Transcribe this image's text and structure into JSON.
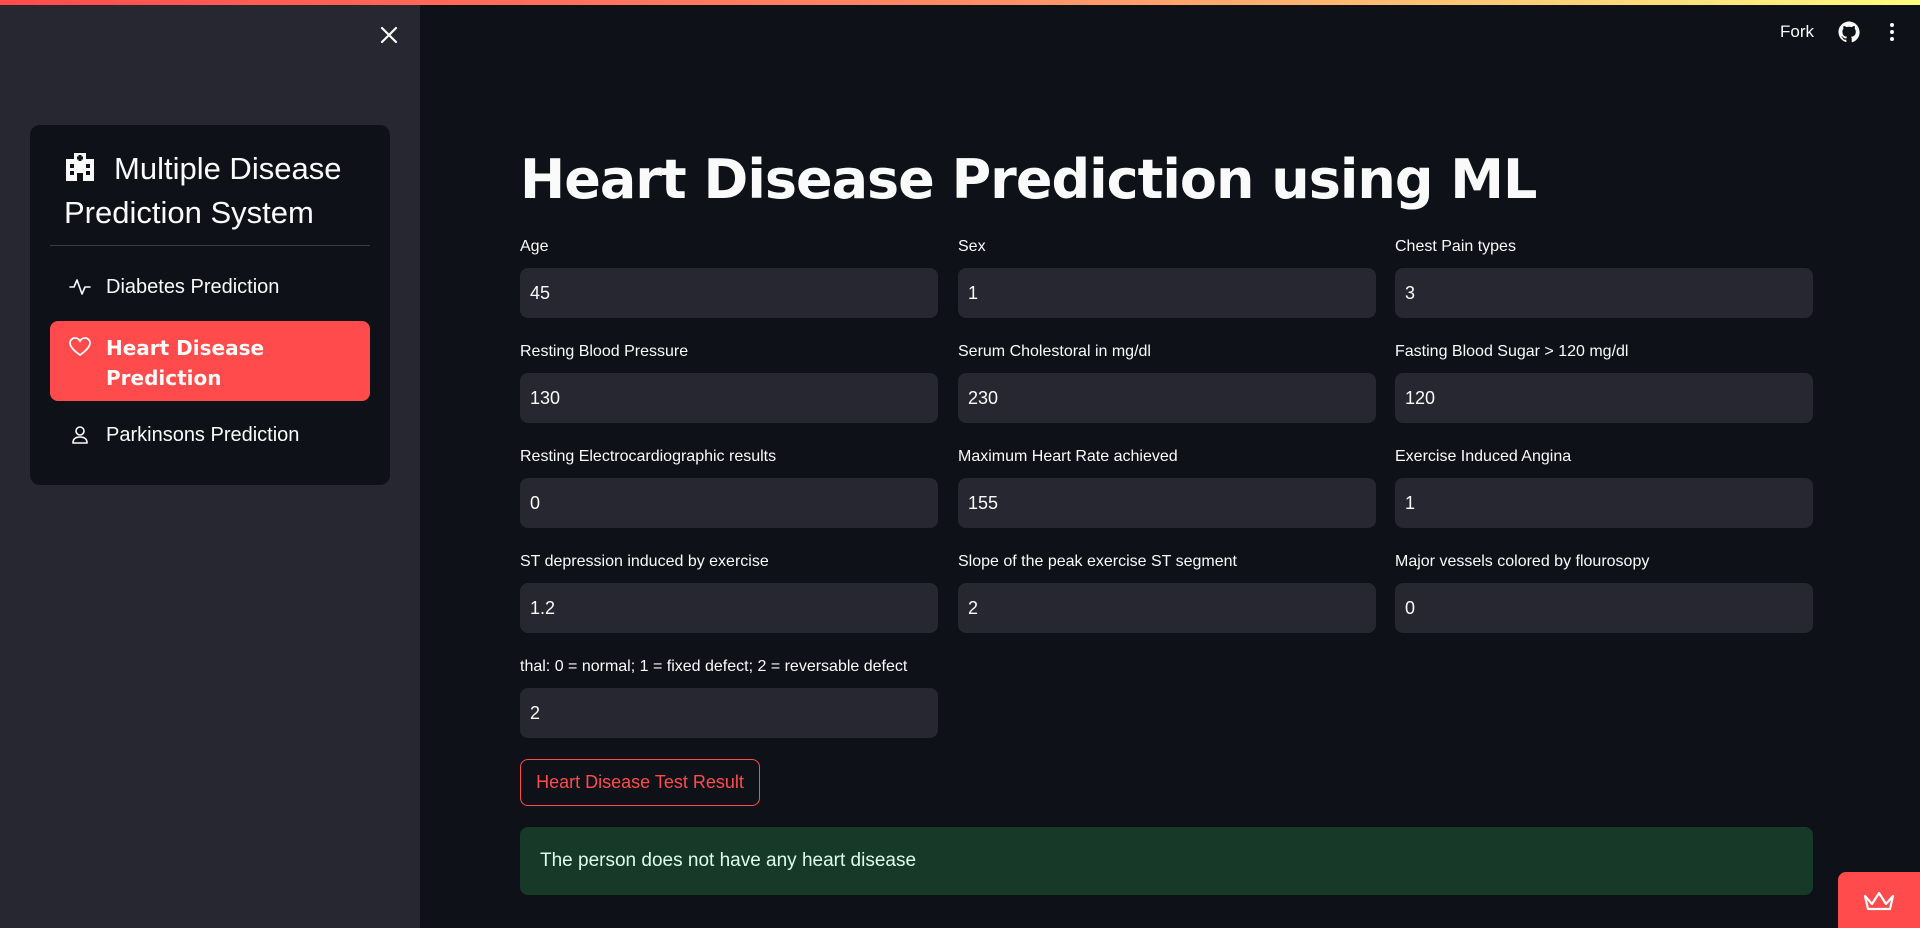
{
  "header": {
    "fork_label": "Fork",
    "icons": [
      "close-icon",
      "github-icon",
      "kebab-menu-icon"
    ]
  },
  "sidebar": {
    "title": "Multiple Disease Prediction System",
    "items": [
      {
        "label": "Diabetes Prediction",
        "icon": "activity-icon",
        "active": false
      },
      {
        "label": "Heart Disease Prediction",
        "icon": "heart-icon",
        "active": true
      },
      {
        "label": "Parkinsons Prediction",
        "icon": "person-icon",
        "active": false
      }
    ]
  },
  "main": {
    "title": "Heart Disease Prediction using ML",
    "fields": [
      {
        "label": "Age",
        "value": "45"
      },
      {
        "label": "Sex",
        "value": "1"
      },
      {
        "label": "Chest Pain types",
        "value": "3"
      },
      {
        "label": "Resting Blood Pressure",
        "value": "130"
      },
      {
        "label": "Serum Cholestoral in mg/dl",
        "value": "230"
      },
      {
        "label": "Fasting Blood Sugar > 120 mg/dl",
        "value": "120"
      },
      {
        "label": "Resting Electrocardiographic results",
        "value": "0"
      },
      {
        "label": "Maximum Heart Rate achieved",
        "value": "155"
      },
      {
        "label": "Exercise Induced Angina",
        "value": "1"
      },
      {
        "label": "ST depression induced by exercise",
        "value": "1.2"
      },
      {
        "label": "Slope of the peak exercise ST segment",
        "value": "2"
      },
      {
        "label": "Major vessels colored by flourosopy",
        "value": "0"
      },
      {
        "label": "thal: 0 = normal; 1 = fixed defect; 2 = reversable defect",
        "value": "2"
      }
    ],
    "button_label": "Heart Disease Test Result",
    "result_text": "The person does not have any heart disease"
  },
  "colors": {
    "accent": "#ff4b4b",
    "background": "#0e1117",
    "sidebar": "#262730",
    "input_bg": "#262730",
    "success_bg": "#173928",
    "success_text": "#dffde9"
  }
}
